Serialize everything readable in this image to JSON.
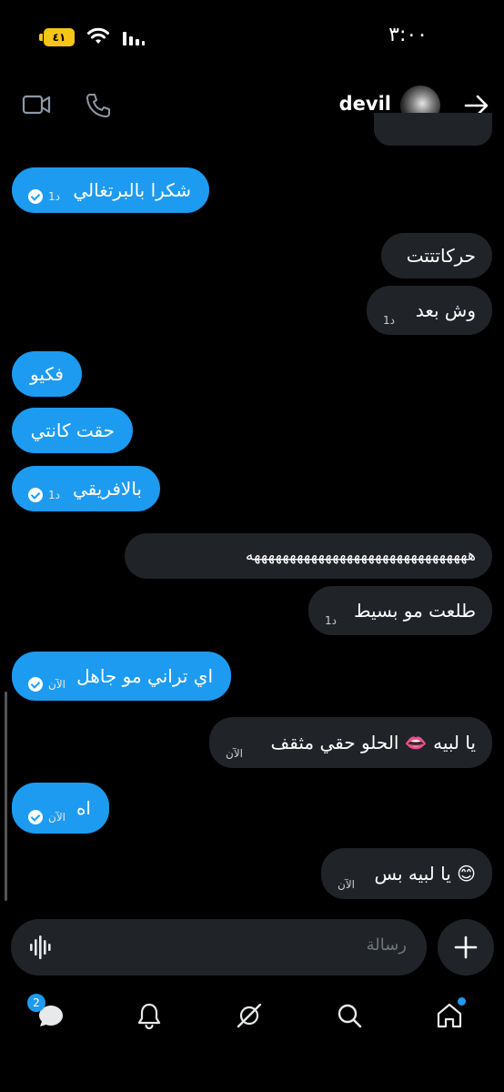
{
  "status_bar": {
    "time": "٣:٠٠",
    "battery": "٤١"
  },
  "header": {
    "contact_name": "devil"
  },
  "messages": [
    {
      "text": "شكرا بالبرتغالي",
      "meta": "1د",
      "direction": "out",
      "read": true
    },
    {
      "text": "حركاتتتت",
      "meta": "",
      "direction": "in"
    },
    {
      "text": "وش بعد",
      "meta": "1د",
      "direction": "in"
    },
    {
      "text": "فكيو",
      "meta": "",
      "direction": "out"
    },
    {
      "text": "حقت كانتي",
      "meta": "",
      "direction": "out"
    },
    {
      "text": "بالافريقي",
      "meta": "1د",
      "direction": "out",
      "read": true
    },
    {
      "text": "هههههههههههههههههههههههههههههههه",
      "meta": "",
      "direction": "in"
    },
    {
      "text": "طلعت مو بسيط",
      "meta": "1د",
      "direction": "in"
    },
    {
      "text": "اي تراني مو جاهل",
      "meta": "الآن",
      "direction": "out",
      "read": true
    },
    {
      "text": "يا لبيه 👄 الحلو حقي مثقف",
      "meta": "الآن",
      "direction": "in"
    },
    {
      "text": "اه",
      "meta": "الآن",
      "direction": "out",
      "read": true
    },
    {
      "text": "يا لبيه بس 😊",
      "meta": "الآن",
      "direction": "in"
    }
  ],
  "composer": {
    "placeholder": "رسالة"
  },
  "bottom_nav": {
    "messages_badge": "2",
    "items": [
      "messages-icon",
      "bell-icon",
      "grok-icon",
      "search-icon",
      "home-icon"
    ]
  },
  "colors": {
    "accent": "#1d9bf0",
    "incoming_bubble": "#202327",
    "background": "#000000"
  }
}
